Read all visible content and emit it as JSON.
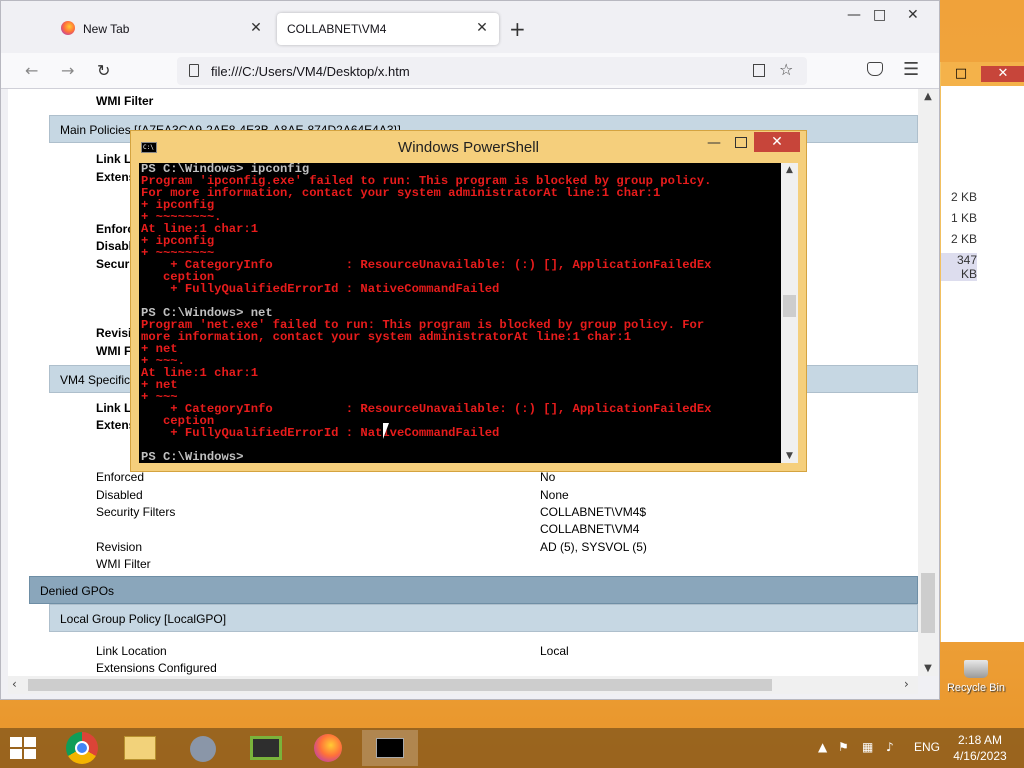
{
  "browser": {
    "tabs": [
      {
        "label": "New Tab"
      },
      {
        "label": "COLLABNET\\VM4"
      }
    ],
    "tab_close": "✕",
    "new_tab": "+",
    "window_controls": {
      "minimize": "—",
      "maximize": "□",
      "close": "✕"
    },
    "nav": {
      "back": "←",
      "forward": "→",
      "reload": "↻"
    },
    "url": "file:///C:/Users/VM4/Desktop/x.htm",
    "star": "☆",
    "menu": "☰"
  },
  "report": {
    "top_rows": [
      {
        "label": "WMI Filter",
        "value": ""
      }
    ],
    "main_policies_header": "Main Policies [{A7EA3CA9-2AE8-4E3B-A8AE-874D2A64E4A3}]",
    "main_policies_labels": [
      "Link L",
      "Extens",
      "Enforc",
      "Disabl",
      "Securi",
      "Revisi",
      "WMI F"
    ],
    "vm4_header": "VM4 Specific",
    "vm4_labels": [
      "Link L",
      "Extens"
    ],
    "vm4_rows": [
      {
        "label": "Enforced",
        "value": "No"
      },
      {
        "label": "Disabled",
        "value": "None"
      },
      {
        "label": "Security Filters",
        "value": "COLLABNET\\VM4$"
      },
      {
        "label": "",
        "value": "COLLABNET\\VM4"
      },
      {
        "label": "Revision",
        "value": "AD (5), SYSVOL (5)"
      },
      {
        "label": "WMI Filter",
        "value": ""
      }
    ],
    "denied_header": "Denied GPOs",
    "local_header": "Local Group Policy [LocalGPO]",
    "local_rows": [
      {
        "label": "Link Location",
        "value": "Local"
      },
      {
        "label": "Extensions Configured",
        "value": ""
      }
    ]
  },
  "powershell": {
    "title": "Windows PowerShell",
    "icon_text": "C:\\",
    "controls": {
      "minimize": "—",
      "close": "✕"
    },
    "lines": [
      {
        "t": "PS C:\\Windows> ipconfig",
        "c": "w"
      },
      {
        "t": "Program 'ipconfig.exe' failed to run: This program is blocked by group policy.",
        "c": "r"
      },
      {
        "t": "For more information, contact your system administratorAt line:1 char:1",
        "c": "r"
      },
      {
        "t": "+ ipconfig",
        "c": "r"
      },
      {
        "t": "+ ~~~~~~~~.",
        "c": "r"
      },
      {
        "t": "At line:1 char:1",
        "c": "r"
      },
      {
        "t": "+ ipconfig",
        "c": "r"
      },
      {
        "t": "+ ~~~~~~~~",
        "c": "r"
      },
      {
        "t": "    + CategoryInfo          : ResourceUnavailable: (:) [], ApplicationFailedEx",
        "c": "r"
      },
      {
        "t": "   ception",
        "c": "r"
      },
      {
        "t": "    + FullyQualifiedErrorId : NativeCommandFailed",
        "c": "r"
      },
      {
        "t": "",
        "c": "w"
      },
      {
        "t": "PS C:\\Windows> net",
        "c": "w"
      },
      {
        "t": "Program 'net.exe' failed to run: This program is blocked by group policy. For",
        "c": "r"
      },
      {
        "t": "more information, contact your system administratorAt line:1 char:1",
        "c": "r"
      },
      {
        "t": "+ net",
        "c": "r"
      },
      {
        "t": "+ ~~~.",
        "c": "r"
      },
      {
        "t": "At line:1 char:1",
        "c": "r"
      },
      {
        "t": "+ net",
        "c": "r"
      },
      {
        "t": "+ ~~~",
        "c": "r"
      },
      {
        "t": "    + CategoryInfo          : ResourceUnavailable: (:) [], ApplicationFailedEx",
        "c": "r"
      },
      {
        "t": "   ception",
        "c": "r"
      },
      {
        "t": "    + FullyQualifiedErrorId : NativeCommandFailed",
        "c": "r"
      },
      {
        "t": "",
        "c": "w"
      },
      {
        "t": "PS C:\\Windows>",
        "c": "w"
      }
    ]
  },
  "explorer": {
    "sizes": [
      "2 KB",
      "1 KB",
      "2 KB",
      "347 KB"
    ],
    "controls": {
      "maximize": "□",
      "close": "✕"
    }
  },
  "desktop": {
    "recycle_bin": "Recycle Bin"
  },
  "taskbar": {
    "lang": "ENG",
    "time": "2:18 AM",
    "date": "4/16/2023",
    "tray_arrow": "▲"
  }
}
